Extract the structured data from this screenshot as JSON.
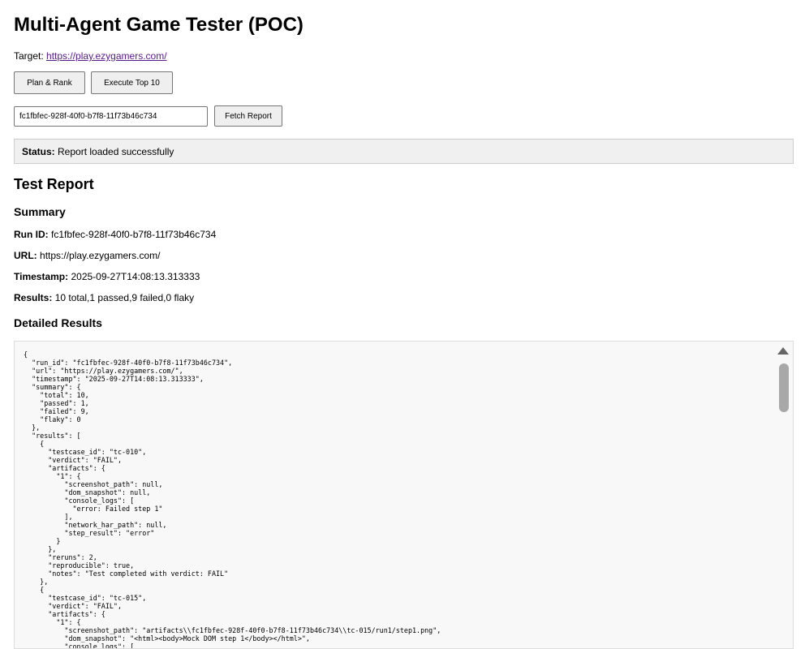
{
  "title": "Multi-Agent Game Tester (POC)",
  "target": {
    "label": "Target:",
    "url": "https://play.ezygamers.com/"
  },
  "buttons": {
    "plan": "Plan & Rank",
    "execute": "Execute Top 10",
    "fetch": "Fetch Report"
  },
  "run_input": {
    "value": "fc1fbfec-928f-40f0-b7f8-11f73b46c734"
  },
  "status": {
    "label": "Status:",
    "text": "Report loaded successfully"
  },
  "report": {
    "heading": "Test Report",
    "summary_heading": "Summary",
    "run_id": {
      "label": "Run ID:",
      "value": "fc1fbfec-928f-40f0-b7f8-11f73b46c734"
    },
    "url": {
      "label": "URL:",
      "value": "https://play.ezygamers.com/"
    },
    "timestamp": {
      "label": "Timestamp:",
      "value": "2025-09-27T14:08:13.313333"
    },
    "results": {
      "label": "Results:",
      "value": "10 total,1 passed,9 failed,0 flaky"
    },
    "detailed_heading": "Detailed Results",
    "json_text": "{\n  \"run_id\": \"fc1fbfec-928f-40f0-b7f8-11f73b46c734\",\n  \"url\": \"https://play.ezygamers.com/\",\n  \"timestamp\": \"2025-09-27T14:08:13.313333\",\n  \"summary\": {\n    \"total\": 10,\n    \"passed\": 1,\n    \"failed\": 9,\n    \"flaky\": 0\n  },\n  \"results\": [\n    {\n      \"testcase_id\": \"tc-010\",\n      \"verdict\": \"FAIL\",\n      \"artifacts\": {\n        \"1\": {\n          \"screenshot_path\": null,\n          \"dom_snapshot\": null,\n          \"console_logs\": [\n            \"error: Failed step 1\"\n          ],\n          \"network_har_path\": null,\n          \"step_result\": \"error\"\n        }\n      },\n      \"reruns\": 2,\n      \"reproducible\": true,\n      \"notes\": \"Test completed with verdict: FAIL\"\n    },\n    {\n      \"testcase_id\": \"tc-015\",\n      \"verdict\": \"FAIL\",\n      \"artifacts\": {\n        \"1\": {\n          \"screenshot_path\": \"artifacts\\\\fc1fbfec-928f-40f0-b7f8-11f73b46c734\\\\tc-015/run1/step1.png\",\n          \"dom_snapshot\": \"<html><body>Mock DOM step 1</body></html>\",\n          \"console_logs\": ["
  }
}
